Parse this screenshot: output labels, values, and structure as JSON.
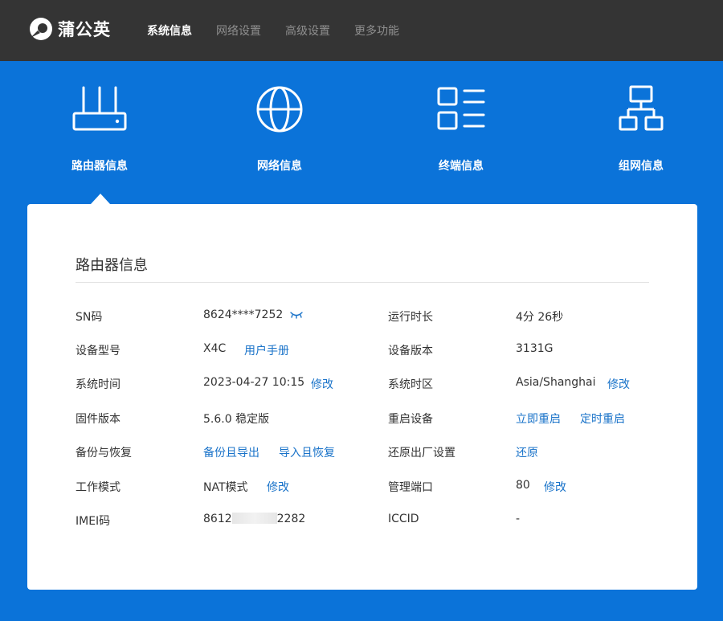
{
  "header": {
    "logo_text": "蒲公英",
    "nav": [
      {
        "label": "系统信息",
        "active": true
      },
      {
        "label": "网络设置",
        "active": false
      },
      {
        "label": "高级设置",
        "active": false
      },
      {
        "label": "更多功能",
        "active": false
      }
    ]
  },
  "categories": [
    {
      "label": "路由器信息",
      "icon": "router-icon",
      "selected": true
    },
    {
      "label": "网络信息",
      "icon": "globe-icon"
    },
    {
      "label": "终端信息",
      "icon": "list-icon"
    },
    {
      "label": "组网信息",
      "icon": "network-icon"
    }
  ],
  "card": {
    "title": "路由器信息",
    "rows": [
      {
        "left": {
          "label": "SN码",
          "value": "8624****7252",
          "icon": "eye-closed-icon"
        },
        "right": {
          "label": "运行时长",
          "value": "4分 26秒"
        }
      },
      {
        "left": {
          "label": "设备型号",
          "value": "X4C",
          "link": "用户手册"
        },
        "right": {
          "label": "设备版本",
          "value": "3131G"
        }
      },
      {
        "left": {
          "label": "系统时间",
          "value": "2023-04-27 10:15",
          "link": "修改"
        },
        "right": {
          "label": "系统时区",
          "value": "Asia/Shanghai",
          "link": "修改"
        }
      },
      {
        "left": {
          "label": "固件版本",
          "value": "5.6.0 稳定版"
        },
        "right": {
          "label": "重启设备",
          "link": "立即重启",
          "link2": "定时重启"
        }
      },
      {
        "left": {
          "label": "备份与恢复",
          "link": "备份且导出",
          "link2": "导入且恢复"
        },
        "right": {
          "label": "还原出厂设置",
          "link": "还原"
        }
      },
      {
        "left": {
          "label": "工作模式",
          "value": "NAT模式",
          "link": "修改"
        },
        "right": {
          "label": "管理端口",
          "value": "80",
          "link": "修改"
        }
      },
      {
        "left": {
          "label": "IMEI码",
          "value_prefix": "8612",
          "value_suffix": "2282"
        },
        "right": {
          "label": "ICCID",
          "value": "-"
        }
      }
    ]
  },
  "colors": {
    "header_bg": "#343434",
    "primary_blue": "#0b73d9",
    "link": "#1a73c9"
  }
}
